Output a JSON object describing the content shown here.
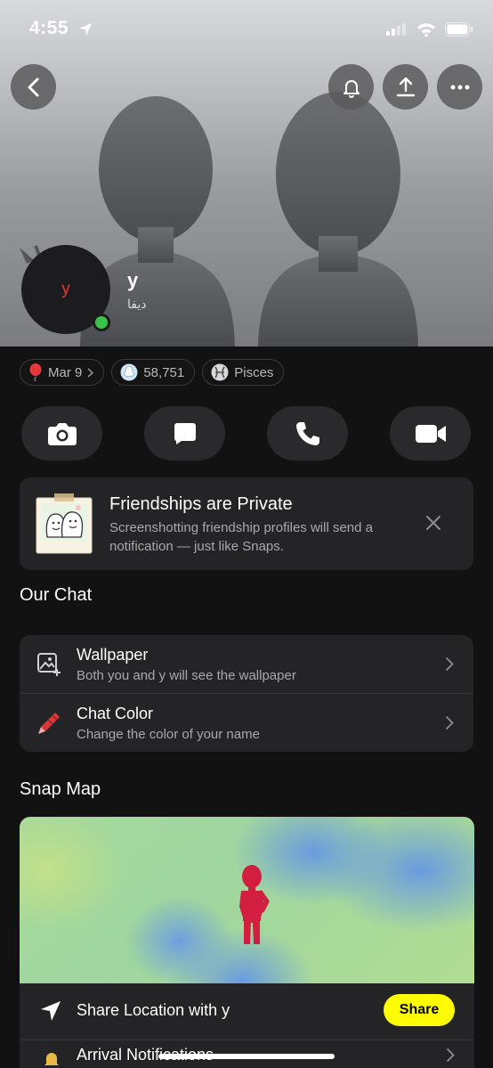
{
  "status_bar": {
    "time": "4:55"
  },
  "profile": {
    "name": "y",
    "avatar_letter": "y",
    "username": "ديفا",
    "online": true
  },
  "chips": [
    {
      "icon": "balloon-icon",
      "label": "Mar 9"
    },
    {
      "icon": "ghost-icon",
      "label": "58,751"
    },
    {
      "icon": "pisces-icon",
      "label": "Pisces"
    }
  ],
  "notice": {
    "title": "Friendships are Private",
    "body": "Screenshotting friendship profiles will send a notification — just like Snaps."
  },
  "our_chat": {
    "title": "Our Chat",
    "items": [
      {
        "title": "Wallpaper",
        "subtitle": "Both you and y will see the wallpaper"
      },
      {
        "title": "Chat Color",
        "subtitle": "Change the color of your name"
      }
    ]
  },
  "snap_map": {
    "title": "Snap Map",
    "share_label": "Share Location with y",
    "share_button": "Share",
    "arrival_label": "Arrival Notifications"
  },
  "colors": {
    "accent": "#fffc00",
    "online": "#3bc44b",
    "background": "#121212",
    "card": "#242426"
  }
}
